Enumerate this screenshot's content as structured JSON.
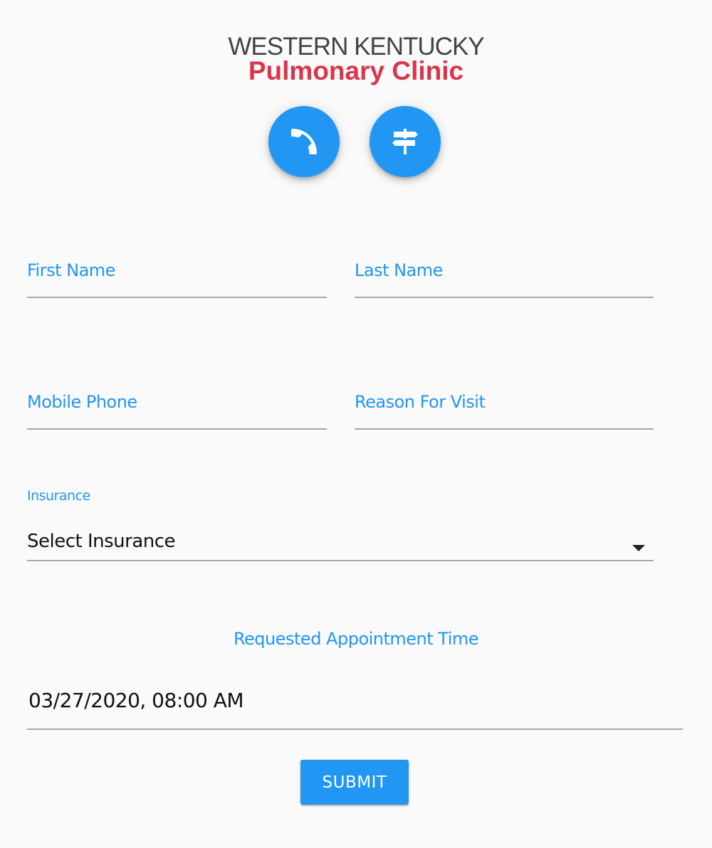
{
  "header": {
    "logo_line1": "WESTERN KENTUCKY",
    "logo_line2": "Pulmonary Clinic",
    "brand_red": "#d9364a",
    "accent_blue": "#2196f3",
    "action_buttons": [
      {
        "icon": "phone-icon"
      },
      {
        "icon": "signpost-directions-icon"
      }
    ]
  },
  "form": {
    "first_name": {
      "label": "First Name",
      "value": ""
    },
    "last_name": {
      "label": "Last Name",
      "value": ""
    },
    "mobile_phone": {
      "label": "Mobile Phone",
      "value": ""
    },
    "reason_for_visit": {
      "label": "Reason For Visit",
      "value": ""
    },
    "insurance": {
      "label": "Insurance",
      "selected": "Select Insurance"
    },
    "appointment": {
      "label": "Requested Appointment Time",
      "value": "03/27/2020, 08:00 AM"
    },
    "submit_label": "SUBMIT"
  }
}
